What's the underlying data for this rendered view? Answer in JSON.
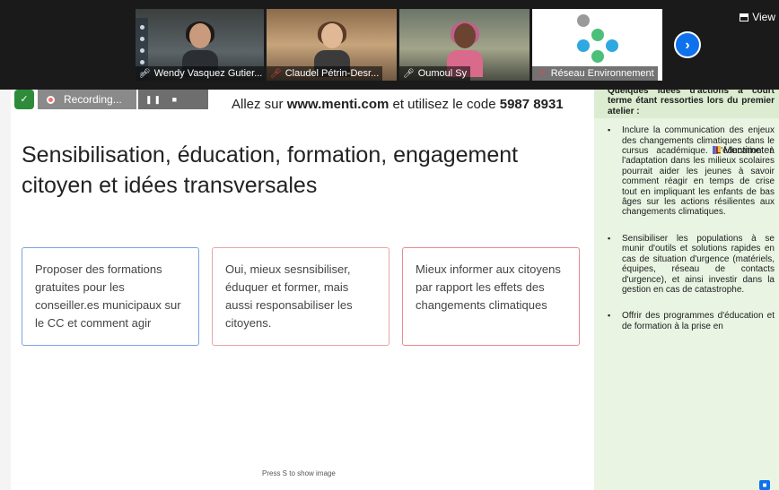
{
  "participants": [
    {
      "name": "Wendy Vasquez Gutier...",
      "muted": false
    },
    {
      "name": "Claudel Pétrin-Desr...",
      "muted": true
    },
    {
      "name": "Oumoul Sy",
      "muted": false
    },
    {
      "name": "Réseau Environnement",
      "muted": true
    }
  ],
  "mic_icon": "microphone-icon",
  "next_icon": "chevron-right-icon",
  "next_glyph": "›",
  "view_label": "View",
  "recording": {
    "label": "Recording...",
    "pause_glyph": "❚❚",
    "stop_glyph": "■",
    "shield_glyph": "✓"
  },
  "menti": {
    "prefix": "Allez sur ",
    "url": "www.menti.com",
    "middle": " et utilisez le code ",
    "code": "5987 8931",
    "brand": "Mentimeter"
  },
  "slide": {
    "title": "Sensibilisation, éducation, formation, engagement citoyen et idées transversales",
    "cards": [
      "Proposer des formations gratuites pour les conseiller.es municipaux sur le CC et comment agir",
      "Oui, mieux sesnsibiliser, éduquer et former, mais aussi responsabiliser les citoyens.",
      "Mieux informer aux citoyens par rapport les effets des changements climatiques"
    ],
    "hint": "Press S to show image"
  },
  "notes": {
    "intro": "Quelques idées d'actions à court terme étant ressorties lors du premier atelier :",
    "items": [
      "Inclure la communication des enjeux des changements climatiques dans le cursus académique. L'éducation à l'adaptation dans les milieux scolaires pourrait aider les jeunes à savoir comment réagir en temps de crise tout en impliquant les enfants de bas âges sur les actions résilientes aux changements climatiques.",
      "Sensibiliser les populations à se munir d'outils et solutions rapides en cas de situation d'urgence (matériels, équipes, réseau de contacts d'urgence), et ainsi investir dans la gestion en cas de catastrophe.",
      "Offrir des programmes d'éducation et de formation à la prise en"
    ]
  },
  "colors": {
    "accent_blue": "#0e72ed",
    "card1_border": "#7ea2e0",
    "card2_border": "#e7a5a8",
    "card3_border": "#e88a8e",
    "side_panel_bg": "#e9f4e3",
    "logo_gray": "#9a9a9a",
    "logo_green": "#4cbf7a",
    "logo_blue": "#2ea8e0"
  }
}
